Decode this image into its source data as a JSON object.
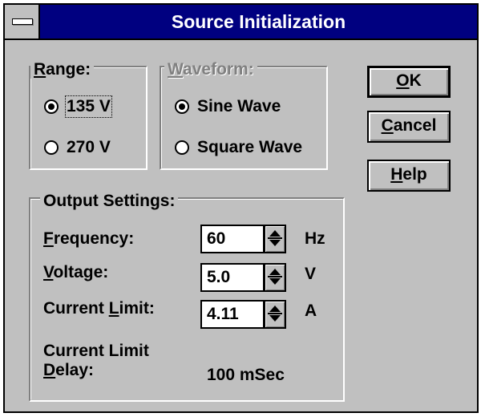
{
  "window": {
    "title": "Source Initialization"
  },
  "range": {
    "legend_accel": "R",
    "legend_rest": "ange:",
    "options": [
      {
        "label": "135 V",
        "selected": true
      },
      {
        "label": "270 V",
        "selected": false
      }
    ]
  },
  "waveform": {
    "legend_accel": "W",
    "legend_rest": "aveform:",
    "disabled": true,
    "options": [
      {
        "label": "Sine Wave",
        "selected": true
      },
      {
        "label": "Square Wave",
        "selected": false
      }
    ]
  },
  "buttons": {
    "ok_accel": "O",
    "ok_rest": "K",
    "cancel_accel": "C",
    "cancel_rest": "ancel",
    "help_accel": "H",
    "help_rest": "elp"
  },
  "output": {
    "legend": "Output Settings:",
    "frequency": {
      "accel": "F",
      "rest": "requency:",
      "value": "60",
      "unit": "Hz"
    },
    "voltage": {
      "accel": "V",
      "rest": "oltage:",
      "value": "5.0",
      "unit": "V"
    },
    "current_limit": {
      "pre": "Current ",
      "accel": "L",
      "rest": "imit:",
      "value": "4.11",
      "unit": "A"
    },
    "delay": {
      "line1": "Current Limit",
      "accel": "D",
      "rest": "elay:",
      "value": "100 mSec"
    }
  },
  "icons": {
    "system_menu": "system-menu-icon",
    "spinner": "spinner-arrows-icon"
  }
}
